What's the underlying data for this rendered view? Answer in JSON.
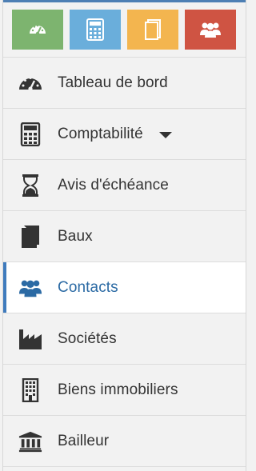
{
  "shortcuts": [
    {
      "name": "dashboard",
      "icon": "gauge-icon",
      "color": "#7db46f"
    },
    {
      "name": "accounting",
      "icon": "calculator-icon",
      "color": "#6aaedb"
    },
    {
      "name": "leases",
      "icon": "book-icon",
      "color": "#f3b54f"
    },
    {
      "name": "contacts",
      "icon": "users-icon",
      "color": "#cf5443"
    }
  ],
  "menu": {
    "items": [
      {
        "label": "Tableau de bord",
        "icon": "gauge-icon"
      },
      {
        "label": "Comptabilité",
        "icon": "calculator-icon",
        "has_dropdown": true
      },
      {
        "label": "Avis d'échéance",
        "icon": "hourglass-icon"
      },
      {
        "label": "Baux",
        "icon": "book-icon"
      },
      {
        "label": "Contacts",
        "icon": "users-icon",
        "active": true
      },
      {
        "label": "Sociétés",
        "icon": "factory-icon"
      },
      {
        "label": "Biens immobiliers",
        "icon": "building-icon"
      },
      {
        "label": "Bailleur",
        "icon": "bank-icon"
      }
    ]
  },
  "colors": {
    "active_text": "#2b6aa4",
    "active_accent": "#3f7bbd",
    "text": "#333333"
  }
}
